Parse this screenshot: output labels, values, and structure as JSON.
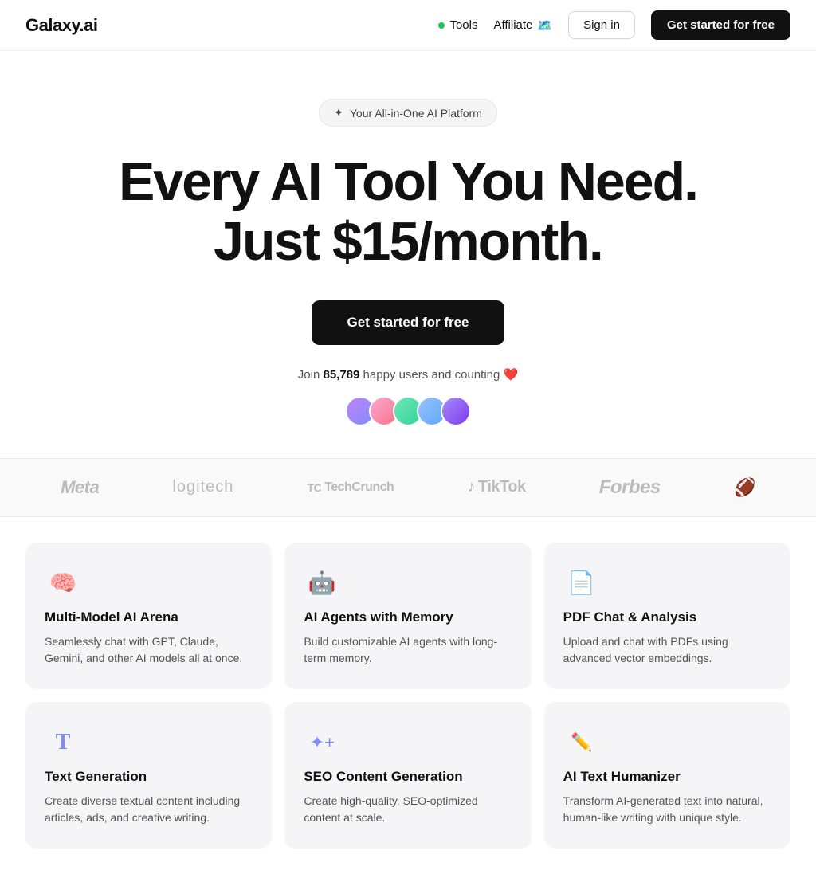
{
  "nav": {
    "logo": "Galaxy.ai",
    "tools_label": "Tools",
    "tools_dot_color": "#22c55e",
    "affiliate_label": "Affiliate",
    "affiliate_emoji": "🗺️",
    "signin_label": "Sign in",
    "cta_label": "Get started for free"
  },
  "hero": {
    "badge_icon": "✦",
    "badge_text": "Your All-in-One AI Platform",
    "title_line1": "Every AI Tool You Need.",
    "title_line2": "Just $15/month.",
    "cta_label": "Get started for free",
    "social_text_pre": "Join ",
    "social_count": "85,789",
    "social_text_post": " happy users and counting ❤️"
  },
  "logos": [
    {
      "label": "Meta",
      "class": "logo-meta"
    },
    {
      "label": "logitech",
      "class": "logo-logitech"
    },
    {
      "label": "TechCrunch",
      "class": "logo-techcrunch"
    },
    {
      "label": "TikTok",
      "class": "logo-tiktok"
    },
    {
      "label": "Forbes",
      "class": "logo-forbes"
    },
    {
      "label": "🏈",
      "class": "logo-nfl"
    }
  ],
  "cards": [
    {
      "icon": "🧠",
      "icon_color": "#818cf8",
      "title": "Multi-Model AI Arena",
      "desc": "Seamlessly chat with GPT, Claude, Gemini, and other AI models all at once."
    },
    {
      "icon": "🤖",
      "icon_color": "#c084fc",
      "title": "AI Agents with Memory",
      "desc": "Build customizable AI agents with long-term memory."
    },
    {
      "icon": "📄",
      "icon_color": "#fbbf24",
      "title": "PDF Chat & Analysis",
      "desc": "Upload and chat with PDFs using advanced vector embeddings."
    },
    {
      "icon": "T",
      "icon_color": "#818cf8",
      "title": "Text Generation",
      "desc": "Create diverse textual content including articles, ads, and creative writing."
    },
    {
      "icon": "✦+",
      "icon_color": "#818cf8",
      "title": "SEO Content Generation",
      "desc": "Create high-quality, SEO-optimized content at scale."
    },
    {
      "icon": "✏️",
      "icon_color": "#818cf8",
      "title": "AI Text Humanizer",
      "desc": "Transform AI-generated text into natural, human-like writing with unique style."
    }
  ]
}
